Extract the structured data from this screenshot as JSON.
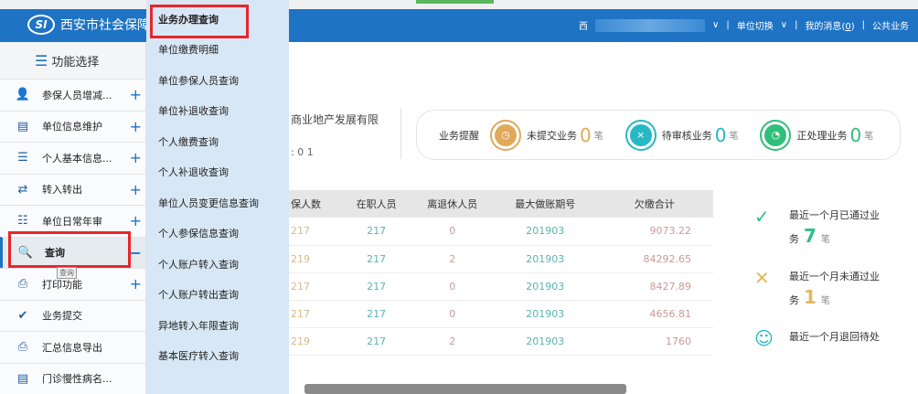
{
  "header": {
    "logo_text": "SI",
    "title": "西安市社会保障",
    "user_prefix": "西",
    "switch_unit": "单位切换",
    "messages_label": "我的消息",
    "messages_count": "0",
    "public": "公共业务"
  },
  "sidebar": {
    "title": "功能选择",
    "items": [
      {
        "label": "参保人员增减...",
        "icon": "user-add-icon",
        "toggle": "+"
      },
      {
        "label": "单位信息维护",
        "icon": "info-icon",
        "toggle": "+"
      },
      {
        "label": "个人基本信息...",
        "icon": "person-card-icon",
        "toggle": "+"
      },
      {
        "label": "转入转出",
        "icon": "transfer-icon",
        "toggle": "+"
      },
      {
        "label": "单位日常年审",
        "icon": "checklist-icon",
        "toggle": "+"
      },
      {
        "label": "查询",
        "icon": "search-icon",
        "toggle": "−"
      },
      {
        "label": "打印功能",
        "icon": "printer-icon",
        "toggle": "+"
      },
      {
        "label": "业务提交",
        "icon": "check-circle-icon",
        "toggle": ""
      },
      {
        "label": "汇总信息导出",
        "icon": "export-icon",
        "toggle": ""
      },
      {
        "label": "门诊慢性病名...",
        "icon": "document-icon",
        "toggle": ""
      }
    ],
    "tooltip": "查询"
  },
  "dropdown": [
    "业务办理查询",
    "单位缴费明细",
    "单位参保人员查询",
    "单位补退收查询",
    "个人缴费查询",
    "个人补退收查询",
    "单位人员变更信息查询",
    "个人参保信息查询",
    "个人账户转入查询",
    "个人账户转出查询",
    "异地转入年限查询",
    "基本医疗转入查询"
  ],
  "company": {
    "name": "商业地产发展有限",
    "code": ": 0    1"
  },
  "reminder": {
    "title": "业务提醒",
    "unit": "笔",
    "items": [
      {
        "label": "未提交业务",
        "count": "0",
        "color": "#e0a95a",
        "glyph": "◷"
      },
      {
        "label": "待审核业务",
        "count": "0",
        "color": "#26b8c4",
        "glyph": "×"
      },
      {
        "label": "正处理业务",
        "count": "0",
        "color": "#2fbf7a",
        "glyph": "◔"
      }
    ]
  },
  "table": {
    "headers": [
      "保人数",
      "在职人员",
      "离退休人员",
      "最大做账期号",
      "欠缴合计"
    ],
    "rows": [
      [
        "217",
        "217",
        "0",
        "201903",
        "9073.22"
      ],
      [
        "219",
        "217",
        "2",
        "201903",
        "84292.65"
      ],
      [
        "217",
        "217",
        "0",
        "201903",
        "8427.89"
      ],
      [
        "217",
        "217",
        "0",
        "201903",
        "4656.81"
      ],
      [
        "219",
        "217",
        "2",
        "201903",
        "1760"
      ]
    ]
  },
  "right_panel": [
    {
      "line1": "最近一个月已通过业",
      "line2": "务",
      "count": "7",
      "unit": "笔",
      "color": "#2fbf8a"
    },
    {
      "line1": "最近一个月未通过业",
      "line2": "务",
      "count": "1",
      "unit": "笔",
      "color": "#e0b860"
    },
    {
      "line1": "最近一个月退回待处",
      "line2": "",
      "count": "",
      "unit": "",
      "color": "#26b8c4"
    }
  ]
}
